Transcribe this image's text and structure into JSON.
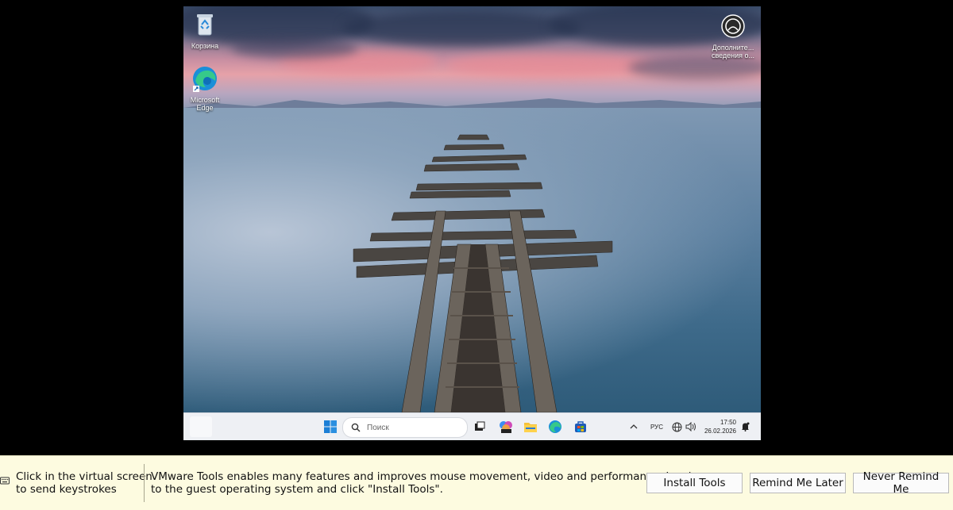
{
  "desktop": {
    "icons": [
      {
        "label": "Корзина",
        "icon": "recycle-bin-icon"
      },
      {
        "label_line1": "Microsoft",
        "label_line2": "Edge",
        "icon": "edge-icon"
      },
      {
        "label_line1": "Дополните...",
        "label_line2": "сведения о...",
        "icon": "help-circle-icon"
      }
    ]
  },
  "taskbar": {
    "search_placeholder": "Поиск",
    "language": "РУС",
    "time": "17:50",
    "date": "26.02.2026",
    "apps": [
      "start-icon",
      "task-view-icon",
      "copilot-icon",
      "file-explorer-icon",
      "edge-icon",
      "store-icon"
    ]
  },
  "notification_bar": {
    "keyboard_hint_line1": "Click in the virtual screen",
    "keyboard_hint_line2": "to send keystrokes",
    "message_line1": "VMware Tools enables many features and improves mouse movement, video and performance. Log in",
    "message_line2": "to the guest operating system and click \"Install Tools\".",
    "install_button": "Install Tools",
    "remind_button": "Remind Me Later",
    "never_button": "Never Remind Me"
  },
  "colors": {
    "notification_background": "#fdfbe0",
    "page_background": "#000000",
    "taskbar_background": "#eef0f4"
  }
}
